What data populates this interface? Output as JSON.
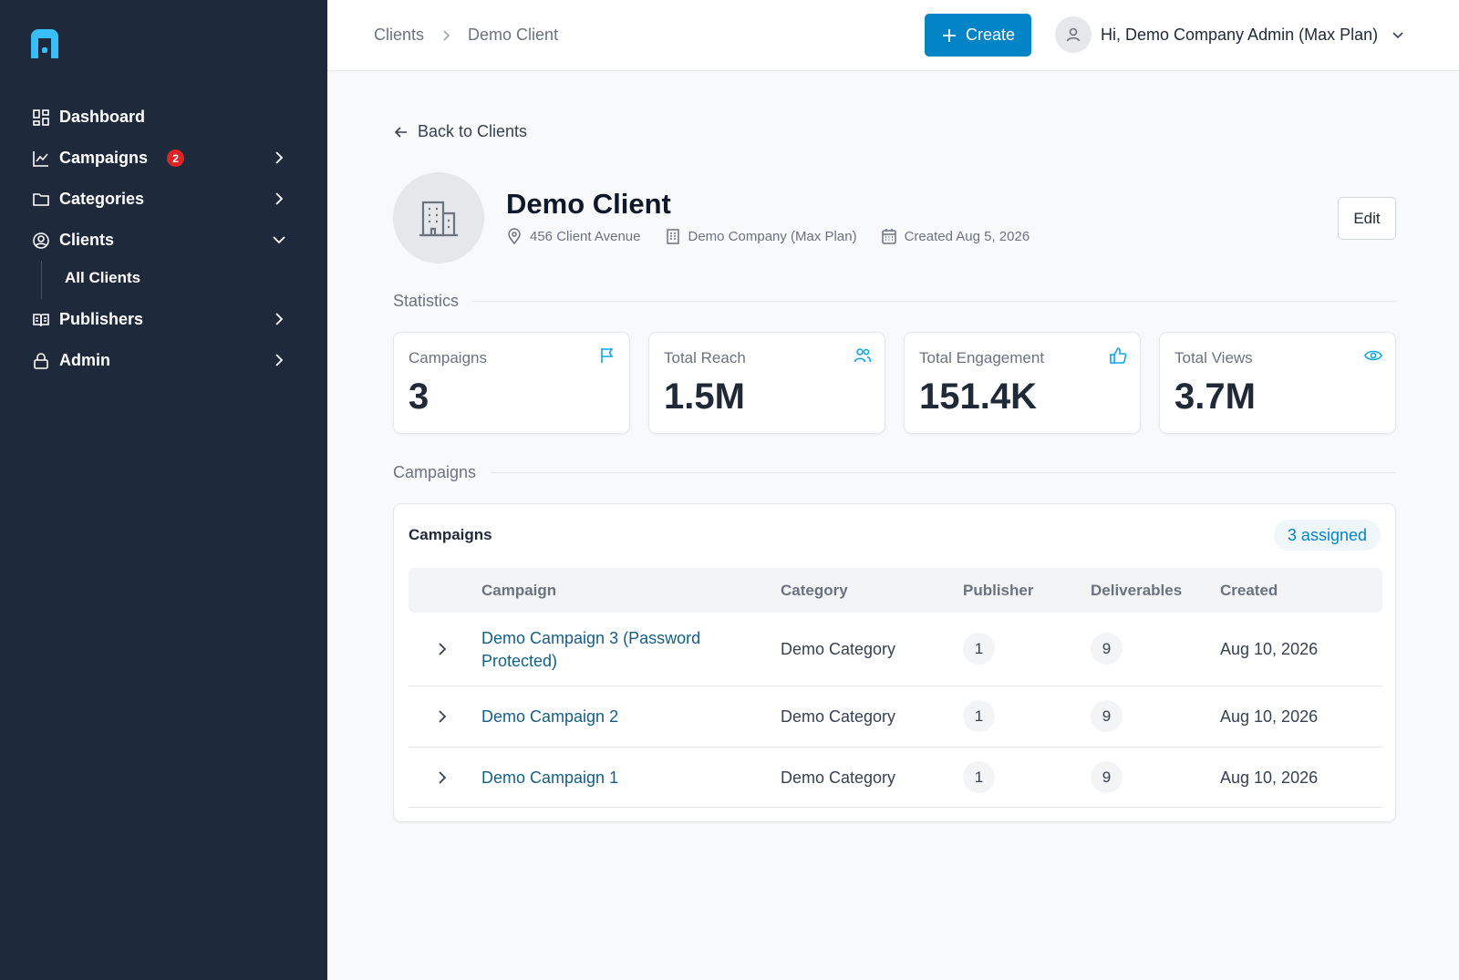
{
  "sidebar": {
    "items": [
      {
        "label": "Dashboard",
        "icon": "dashboard-icon"
      },
      {
        "label": "Campaigns",
        "icon": "chart-line-icon",
        "badge": "2"
      },
      {
        "label": "Categories",
        "icon": "folder-icon"
      },
      {
        "label": "Clients",
        "icon": "user-circle-icon",
        "expanded": true
      },
      {
        "label": "Publishers",
        "icon": "book-open-icon"
      },
      {
        "label": "Admin",
        "icon": "lock-icon"
      }
    ],
    "sub_items": [
      {
        "label": "All Clients"
      }
    ]
  },
  "header": {
    "breadcrumb": [
      "Clients",
      "Demo Client"
    ],
    "create_label": "Create",
    "user_label": "Hi, Demo Company Admin (Max Plan)"
  },
  "client": {
    "back_label": "Back to Clients",
    "name": "Demo Client",
    "address": "456 Client Avenue",
    "company": "Demo Company (Max Plan)",
    "created": "Created Aug 5, 2026",
    "edit_label": "Edit"
  },
  "statistics": {
    "section_label": "Statistics",
    "cards": [
      {
        "label": "Campaigns",
        "value": "3",
        "icon": "flag-icon"
      },
      {
        "label": "Total Reach",
        "value": "1.5M",
        "icon": "users-icon"
      },
      {
        "label": "Total Engagement",
        "value": "151.4K",
        "icon": "thumbs-up-icon"
      },
      {
        "label": "Total Views",
        "value": "3.7M",
        "icon": "eye-icon"
      }
    ]
  },
  "campaigns": {
    "section_label": "Campaigns",
    "card_title": "Campaigns",
    "assigned_label": "3 assigned",
    "columns": [
      "Campaign",
      "Category",
      "Publisher",
      "Deliverables",
      "Created"
    ],
    "rows": [
      {
        "name": "Demo Campaign 3 (Password Protected)",
        "category": "Demo Category",
        "publisher": "1",
        "deliverables": "9",
        "created": "Aug 10, 2026"
      },
      {
        "name": "Demo Campaign 2",
        "category": "Demo Category",
        "publisher": "1",
        "deliverables": "9",
        "created": "Aug 10, 2026"
      },
      {
        "name": "Demo Campaign 1",
        "category": "Demo Category",
        "publisher": "1",
        "deliverables": "9",
        "created": "Aug 10, 2026"
      }
    ]
  },
  "colors": {
    "sidebar_bg": "#1e293b",
    "accent": "#0284c7",
    "badge": "#dc2626",
    "link": "#155e85"
  }
}
